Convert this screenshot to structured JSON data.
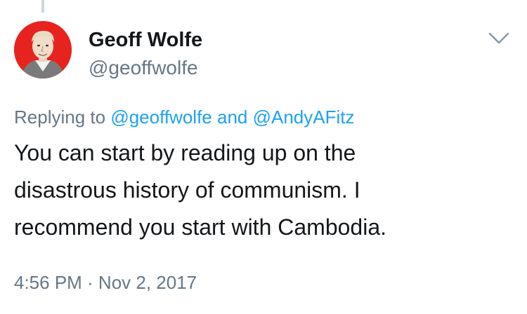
{
  "tweet": {
    "author": {
      "display_name": "Geoff Wolfe",
      "handle": "@geoffwolfe",
      "avatar_icon": "profile-photo"
    },
    "menu_icon": "chevron-down-icon",
    "reply": {
      "prefix": "Replying to ",
      "mentions": [
        "@geoffwolfe",
        "@AndyAFitz"
      ],
      "conjunction": " and "
    },
    "text_lines": [
      "You can start by reading up on the",
      "disastrous history of communism. I",
      "recommend you start with Cambodia."
    ],
    "timestamp": "4:56 PM · Nov 2, 2017"
  },
  "colors": {
    "text_primary": "#14171a",
    "text_secondary": "#657786",
    "link": "#1da1f2",
    "avatar_background": "#e8231f",
    "thread_line": "#ccd6dd"
  }
}
